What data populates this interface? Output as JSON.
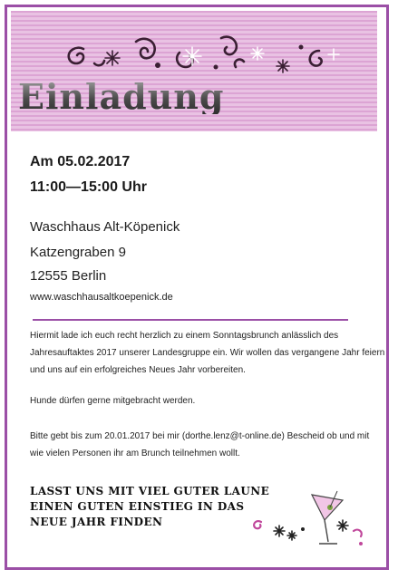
{
  "title": "Einladung",
  "event": {
    "date": "Am 05.02.2017",
    "time": "11:00—15:00 Uhr"
  },
  "venue": {
    "name": "Waschhaus Alt-Köpenick",
    "street": "Katzengraben 9",
    "city": "12555 Berlin",
    "url": "www.waschhausaltkoepenick.de"
  },
  "body": {
    "invitation": "Hiermit lade ich euch recht herzlich zu einem Sonntagsbrunch anlässlich des Jahresauftaktes 2017 unserer Landesgruppe ein. Wir wollen das vergangene Jahr feiern und uns auf ein erfolgreiches Neues Jahr vorbereiten.",
    "dogs": "Hunde dürfen gerne mitgebracht werden.",
    "rsvp": "Bitte gebt bis zum 20.01.2017 bei mir (dorthe.lenz@t-online.de) Bescheid ob und mit wie vielen Personen ihr am Brunch teilnehmen wollt."
  },
  "slogan": {
    "line1": "LASST UNS MIT VIEL GUTER LAUNE",
    "line2": "EINEN GUTEN EINSTIEG IN DAS",
    "line3": "NEUE JAHR FINDEN"
  },
  "colors": {
    "accent": "#9b4fa6",
    "banner": "#e2b3dc",
    "ornament": "#3a1f33",
    "swirl_pink": "#c0479b"
  }
}
